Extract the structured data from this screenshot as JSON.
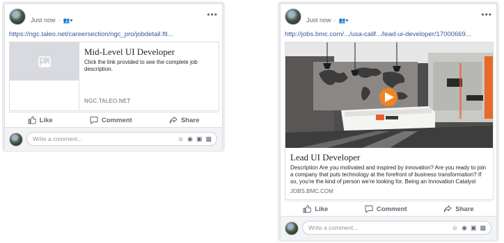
{
  "posts": [
    {
      "timestamp": "Just now",
      "audience_icon": "friends-icon",
      "link_url": "https://ngc.taleo.net/careersection/ngc_pro/jobdetail.ftl...",
      "preview": {
        "title": "Mid-Level UI Developer",
        "description": "Click the link provided to see the complete job description.",
        "domain": "NGC.TALEO.NET"
      },
      "actions": {
        "like": "Like",
        "comment": "Comment",
        "share": "Share"
      },
      "comment_placeholder": "Write a comment..."
    },
    {
      "timestamp": "Just now",
      "audience_icon": "friends-icon",
      "link_url": "http://jobs.bmc.com/.../usa-calif.../lead-ui-developer/17000669...",
      "preview": {
        "title": "Lead UI Developer",
        "description": "Description Are you motivated and inspired by innovation? Are you ready to join a company that puts technology at the forefront of business transformation? If so, you're the kind of person we're looking for. Being an Innovation Catalyst requires a...",
        "domain": "JOBS.BMC.COM",
        "image_signage": "bmc"
      },
      "actions": {
        "like": "Like",
        "comment": "Comment",
        "share": "Share"
      },
      "comment_placeholder": "Write a comment..."
    }
  ],
  "colors": {
    "link": "#365899",
    "muted": "#606770",
    "play": "#f58220",
    "brand_orange": "#f05a28"
  }
}
